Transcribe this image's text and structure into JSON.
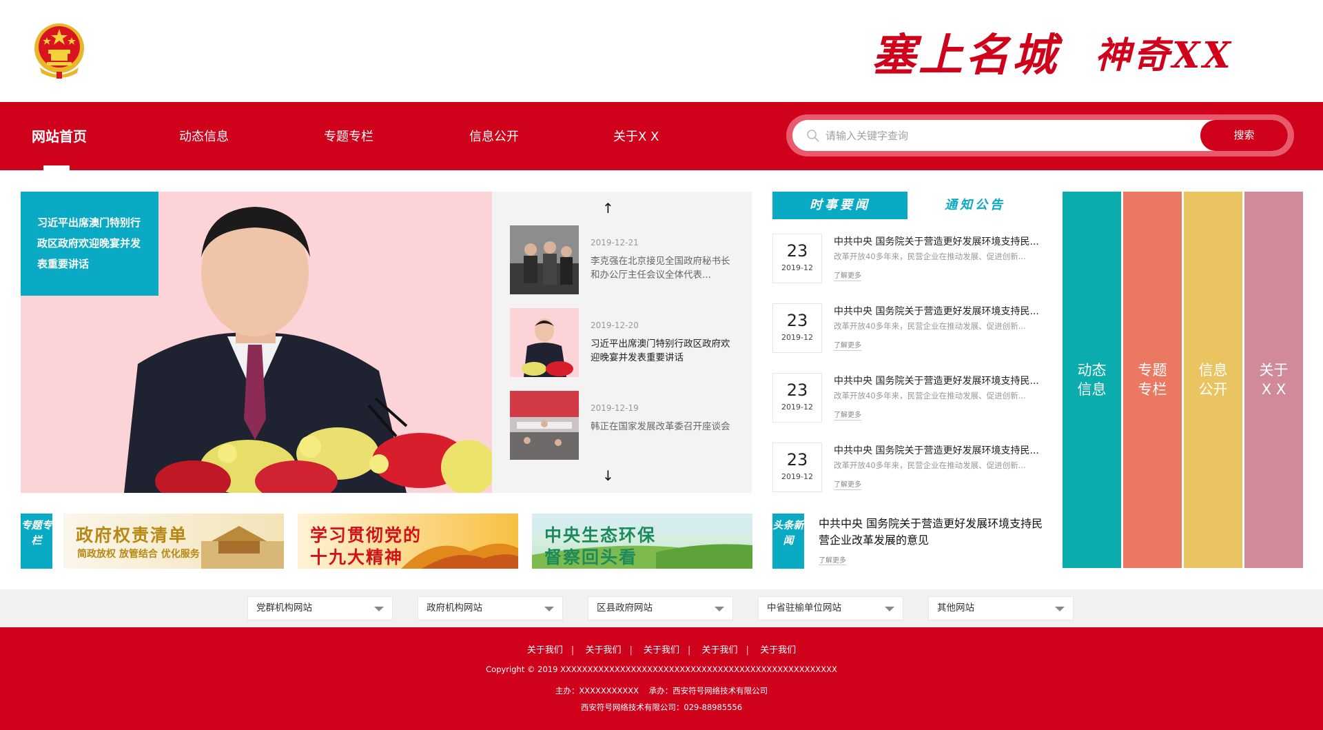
{
  "header": {
    "slogan_part1": "塞上名城",
    "slogan_part2": "神奇XX"
  },
  "nav": {
    "items": [
      {
        "label": "网站首页"
      },
      {
        "label": "动态信息"
      },
      {
        "label": "专题专栏"
      },
      {
        "label": "信息公开"
      },
      {
        "label": "关于X X"
      }
    ]
  },
  "search": {
    "placeholder": "请输入关键字查询",
    "button_label": "搜索"
  },
  "hero": {
    "caption": "习近平出席澳门特别行政区政府欢迎晚宴并发表重要讲话"
  },
  "slider": {
    "up_arrow": "↑",
    "down_arrow": "↓",
    "items": [
      {
        "date": "2019-12-21",
        "title": "李克强在北京接见全国政府秘书长和办公厅主任会议全体代表..."
      },
      {
        "date": "2019-12-20",
        "title": "习近平出席澳门特别行政区政府欢迎晚宴并发表重要讲话"
      },
      {
        "date": "2019-12-19",
        "title": "韩正在国家发展改革委召开座谈会"
      }
    ]
  },
  "tabs": {
    "active": "时事要闻",
    "inactive": "通知公告"
  },
  "news": [
    {
      "day": "23",
      "ym": "2019-12",
      "title": "中共中央 国务院关于营造更好发展环境支持民...",
      "summary": "改革开放40多年来，民营企业在推动发展、促进创新...",
      "more": "了解更多"
    },
    {
      "day": "23",
      "ym": "2019-12",
      "title": "中共中央 国务院关于营造更好发展环境支持民...",
      "summary": "改革开放40多年来，民营企业在推动发展、促进创新...",
      "more": "了解更多"
    },
    {
      "day": "23",
      "ym": "2019-12",
      "title": "中共中央 国务院关于营造更好发展环境支持民...",
      "summary": "改革开放40多年来，民营企业在推动发展、促进创新...",
      "more": "了解更多"
    },
    {
      "day": "23",
      "ym": "2019-12",
      "title": "中共中央 国务院关于营造更好发展环境支持民...",
      "summary": "改革开放40多年来，民营企业在推动发展、促进创新...",
      "more": "了解更多"
    }
  ],
  "columns": [
    {
      "line1": "动态",
      "line2": "信息",
      "color": "#0aacac"
    },
    {
      "line1": "专题",
      "line2": "专栏",
      "color": "#eb7862"
    },
    {
      "line1": "信息",
      "line2": "公开",
      "color": "#e9c461"
    },
    {
      "line1": "关于",
      "line2": "X X",
      "color": "#d08a9a"
    }
  ],
  "special": {
    "label": "专题专栏",
    "banners": [
      {
        "line1": "政府权责清单",
        "line2": "简政放权 放管结合 优化服务"
      },
      {
        "line1": "学习贯彻党的",
        "line2": "十九大精神"
      },
      {
        "line1": "中央生态环保",
        "line2": "督察回头看"
      }
    ]
  },
  "headline": {
    "label": "头条新闻",
    "title": "中共中央 国务院关于营造更好发展环境支持民营企业改革发展的意见",
    "more": "了解更多"
  },
  "links": [
    {
      "label": "党群机构网站"
    },
    {
      "label": "政府机构网站"
    },
    {
      "label": "区县政府网站"
    },
    {
      "label": "中省驻榆单位网站"
    },
    {
      "label": "其他网站"
    }
  ],
  "footer": {
    "links": [
      "关于我们",
      "关于我们",
      "关于我们",
      "关于我们",
      "关于我们"
    ],
    "copyright": "Copyright © 2019 XXXXXXXXXXXXXXXXXXXXXXXXXXXXXXXXXXXXXXXXXXXXXXXXXXX",
    "host": "主办：XXXXXXXXXXX    承办：西安符号网络技术有限公司",
    "phone": "西安符号网络技术有限公司：029-88985556"
  },
  "colors": {
    "brand_red": "#d0021b",
    "accent_teal": "#0aa9c4"
  }
}
